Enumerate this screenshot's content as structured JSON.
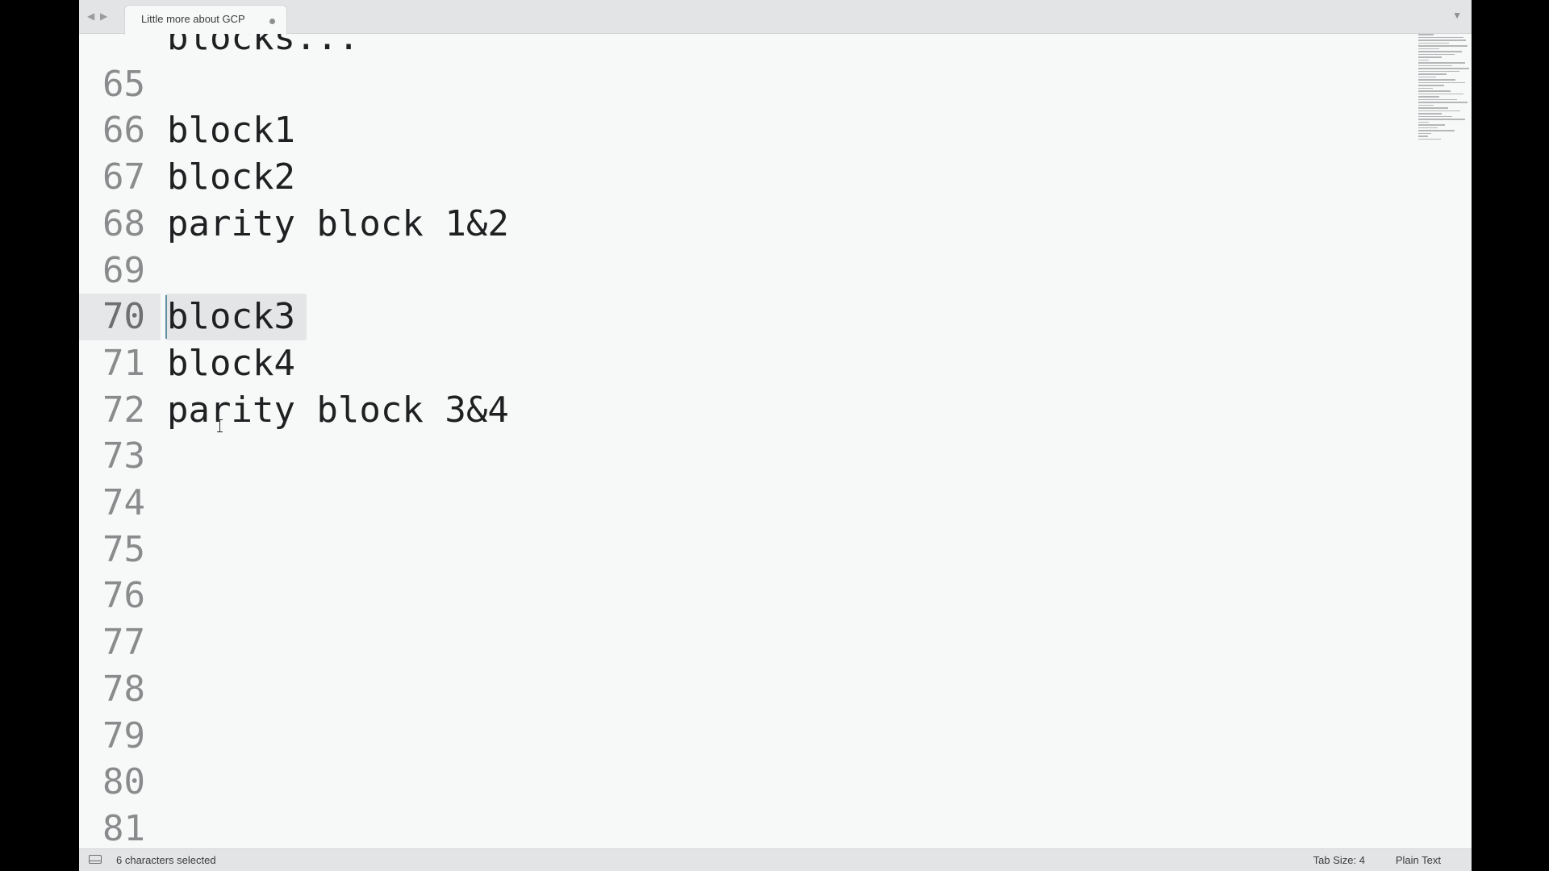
{
  "tab": {
    "title": "Little more about GCP",
    "modified_indicator": "dot"
  },
  "icons": {
    "back": "chevron-left-icon",
    "forward": "chevron-right-icon",
    "tab_menu": "chevron-down-icon",
    "panel": "panel-toggle-icon"
  },
  "editor": {
    "lines": [
      {
        "number": "",
        "text": "blocks..."
      },
      {
        "number": "65",
        "text": ""
      },
      {
        "number": "66",
        "text": "block1"
      },
      {
        "number": "67",
        "text": "block2"
      },
      {
        "number": "68",
        "text": "parity block 1&2"
      },
      {
        "number": "69",
        "text": ""
      },
      {
        "number": "70",
        "text": "block3"
      },
      {
        "number": "71",
        "text": "block4"
      },
      {
        "number": "72",
        "text": "parity block 3&4"
      },
      {
        "number": "73",
        "text": ""
      },
      {
        "number": "74",
        "text": ""
      },
      {
        "number": "75",
        "text": ""
      },
      {
        "number": "76",
        "text": ""
      },
      {
        "number": "77",
        "text": ""
      },
      {
        "number": "78",
        "text": ""
      },
      {
        "number": "79",
        "text": ""
      },
      {
        "number": "80",
        "text": ""
      },
      {
        "number": "81",
        "text": ""
      }
    ],
    "current_line": "70",
    "selected_text": "block3"
  },
  "status": {
    "selection": "6 characters selected",
    "tab_size": "Tab Size: 4",
    "syntax": "Plain Text"
  },
  "colors": {
    "editor_bg": "#f7f8f8",
    "chrome_bg": "#e3e4e5",
    "text": "#1f2021",
    "gutter_text": "#8a8b8c",
    "caret": "#5f8fa3"
  }
}
